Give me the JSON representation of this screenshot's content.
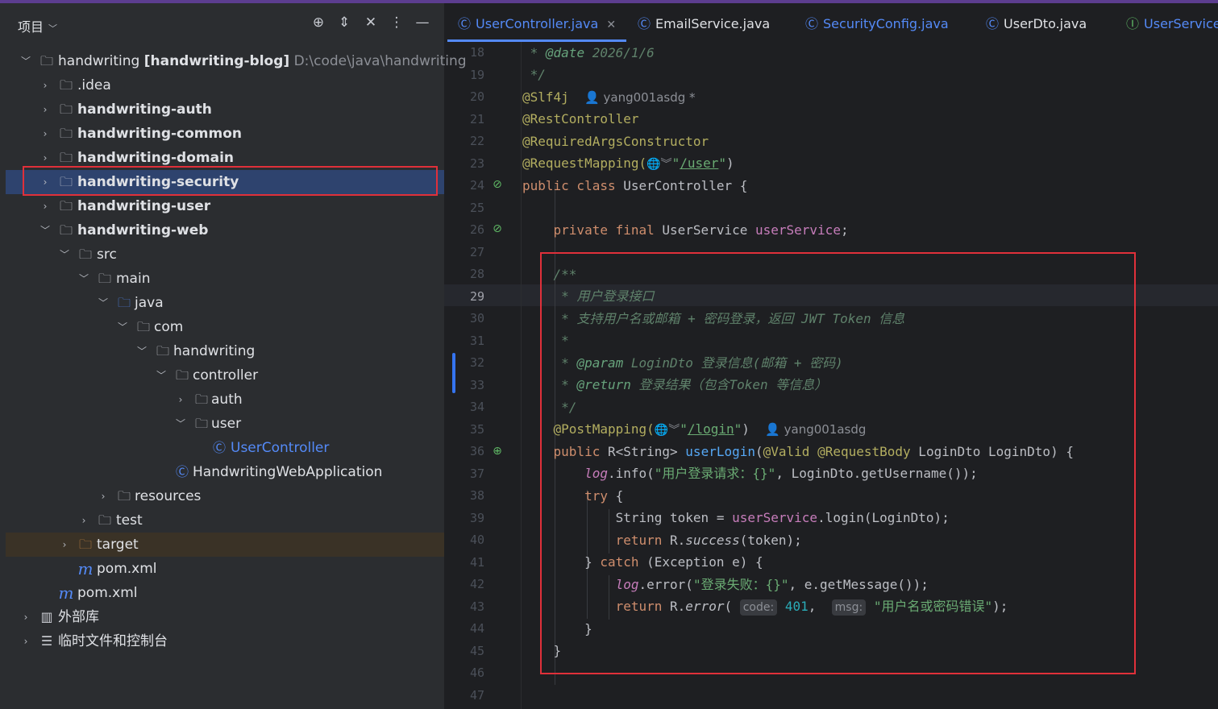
{
  "project_panel": {
    "title": "项目",
    "icons": [
      "locate-icon",
      "expand-collapse-icon",
      "collapse-all-icon",
      "more-icon",
      "minimize-icon"
    ],
    "tree": [
      {
        "name": "handwriting",
        "suffix": "[handwriting-blog]",
        "path": "D:\\code\\java\\handwriting",
        "expanded": true
      },
      {
        "name": ".idea"
      },
      {
        "name": "handwriting-auth"
      },
      {
        "name": "handwriting-common"
      },
      {
        "name": "handwriting-domain"
      },
      {
        "name": "handwriting-security",
        "selected": true
      },
      {
        "name": "handwriting-user"
      },
      {
        "name": "handwriting-web",
        "expanded": true
      },
      {
        "name": "src"
      },
      {
        "name": "main"
      },
      {
        "name": "java"
      },
      {
        "name": "com"
      },
      {
        "name": "handwriting"
      },
      {
        "name": "controller"
      },
      {
        "name": "auth"
      },
      {
        "name": "user"
      },
      {
        "name": "UserController"
      },
      {
        "name": "HandwritingWebApplication"
      },
      {
        "name": "resources"
      },
      {
        "name": "test"
      },
      {
        "name": "target"
      },
      {
        "name": "pom.xml"
      },
      {
        "name": "pom.xml"
      },
      {
        "name": "外部库"
      },
      {
        "name": "临时文件和控制台"
      }
    ]
  },
  "tabs": [
    {
      "label": "UserController.java",
      "active": true
    },
    {
      "label": "EmailService.java"
    },
    {
      "label": "SecurityConfig.java"
    },
    {
      "label": "UserDto.java"
    },
    {
      "label": "UserService"
    }
  ],
  "editor": {
    "line_numbers": [
      "18",
      "19",
      "20",
      "21",
      "22",
      "23",
      "24",
      "25",
      "26",
      "27",
      "28",
      "29",
      "30",
      "31",
      "32",
      "33",
      "34",
      "35",
      "36",
      "37",
      "38",
      "39",
      "40",
      "41",
      "42",
      "43",
      "44",
      "45",
      "46",
      "47"
    ],
    "current_line": "29",
    "author": "yang001asdg",
    "author_modified": "yang001asdg *",
    "hints": {
      "code": "code:",
      "msg": "msg:"
    },
    "tokens": {
      "date_tag": "@date",
      "date_val": " 2026/1/6",
      "slf4j": "@Slf4j",
      "rest": "@RestController",
      "req_args": "@RequiredArgsConstructor",
      "req_map": "@RequestMapping(",
      "user_path": "/user",
      "class_decl": "UserController {",
      "field_type": "UserService ",
      "field_name": "userService",
      "doc1": "用户登录接口",
      "doc2": "支持用户名或邮箱 + 密码登录，返回 JWT Token 信息",
      "param_tag": "@param",
      "param_txt": " LoginDto 登录信息(邮箱 + 密码)",
      "return_tag": "@return",
      "return_txt": " 登录结果（包含Token 等信息）",
      "post_map": "@PostMapping(",
      "login_path": "/login",
      "method_name": "userLogin",
      "valid": "@Valid",
      "req_body": "@RequestBody",
      "log_info_str": "\"用户登录请求：{}\"",
      "log_err_str": "\"登录失败：{}\"",
      "code_val": "401",
      "msg_val": "\"用户名或密码错误\""
    }
  }
}
